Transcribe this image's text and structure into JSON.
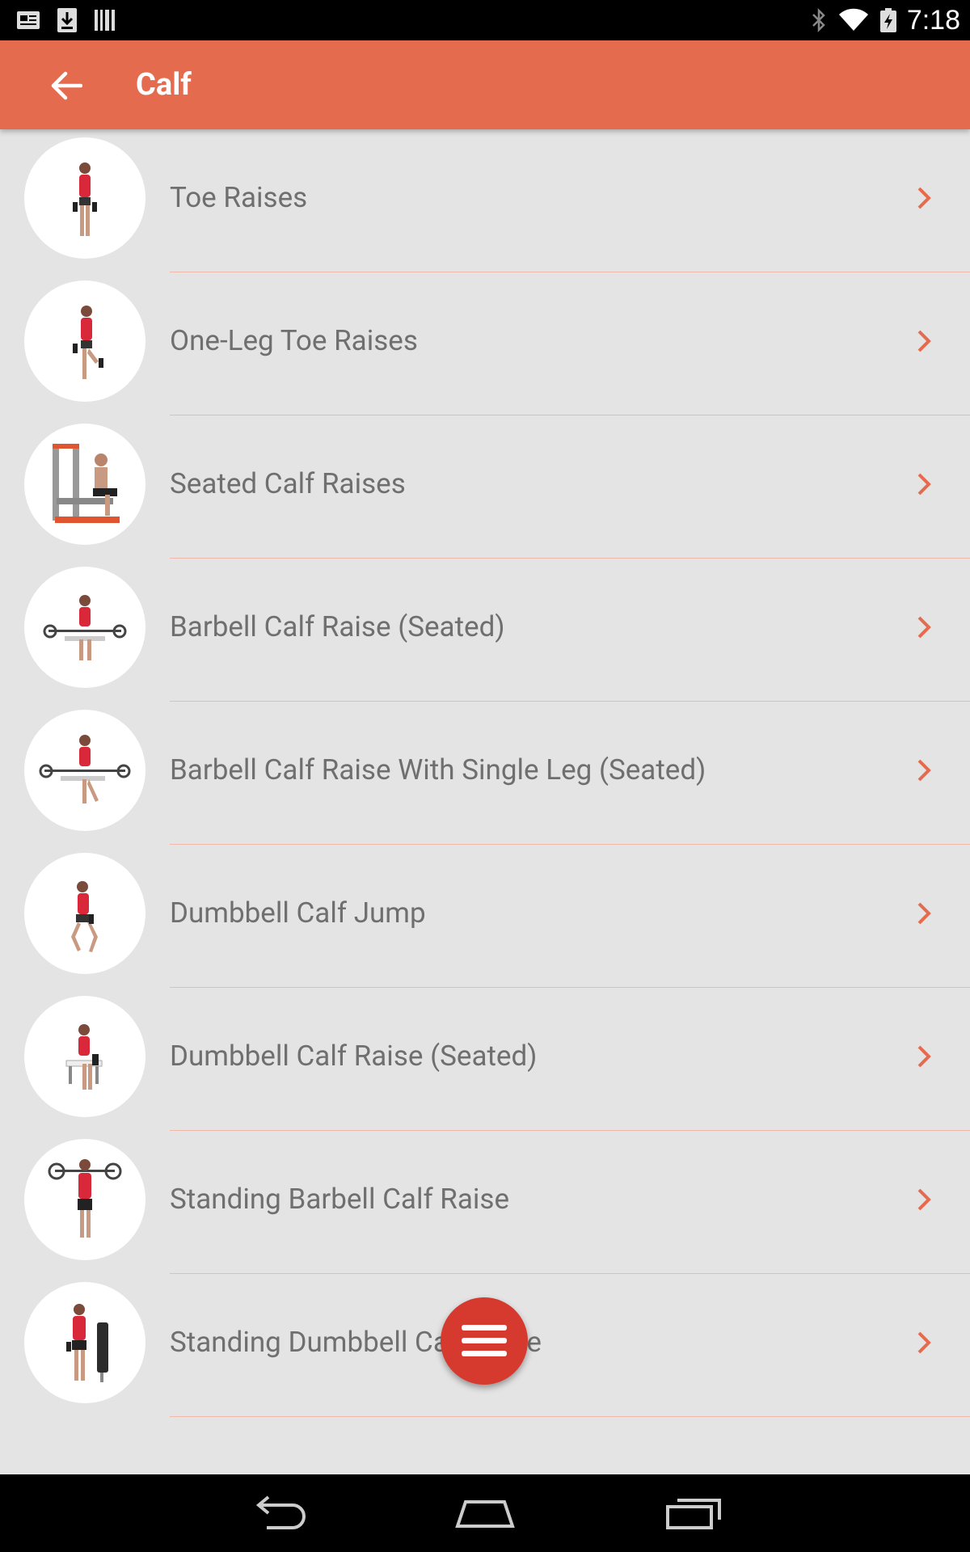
{
  "status_bar": {
    "time": "7:18",
    "icons": [
      "news-icon",
      "download-icon",
      "barcode-icon",
      "bluetooth-icon",
      "wifi-icon",
      "battery-charging-icon"
    ]
  },
  "app_bar": {
    "title": "Calf",
    "back_icon": "arrow-back-icon"
  },
  "exercises": [
    {
      "label": "Toe Raises"
    },
    {
      "label": "One-Leg Toe Raises"
    },
    {
      "label": "Seated Calf Raises"
    },
    {
      "label": "Barbell Calf Raise (Seated)"
    },
    {
      "label": "Barbell Calf Raise With Single Leg (Seated)"
    },
    {
      "label": "Dumbbell Calf Jump"
    },
    {
      "label": "Dumbbell Calf Raise (Seated)"
    },
    {
      "label": "Standing Barbell Calf Raise"
    },
    {
      "label": "Standing Dumbbell Calf Raise"
    }
  ],
  "fab": {
    "icon": "menu-icon"
  },
  "nav_bar": {
    "icons": [
      "nav-back-icon",
      "nav-home-icon",
      "nav-recents-icon"
    ]
  },
  "colors": {
    "accent": "#e56b4f",
    "fab": "#d63a2f",
    "chevron": "#e56b4f",
    "background": "#e4e4e4"
  }
}
